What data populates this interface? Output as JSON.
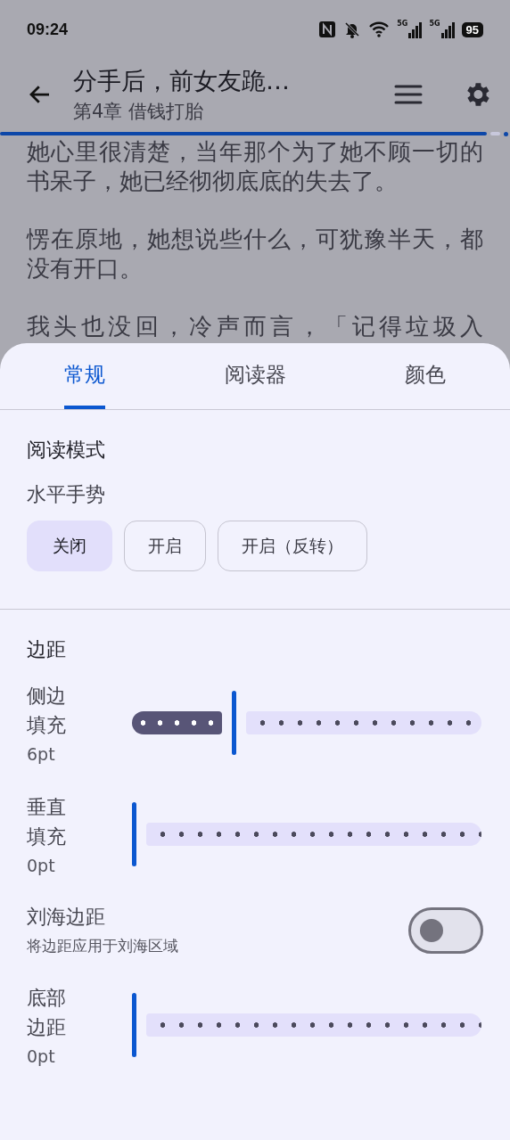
{
  "status_bar": {
    "time": "09:24",
    "signals": [
      "5G",
      "5G"
    ],
    "battery": "95"
  },
  "header": {
    "title": "分手后，前女友跪…",
    "subtitle": "第4章 借钱打胎"
  },
  "reading_progress": {
    "level": 0.955
  },
  "reader": {
    "paragraphs": [
      "她心里很清楚，当年那个为了她不顾一切的书呆子，她已经彻彻底底的失去了。",
      "愣在原地，她想说些什么，可犹豫半天，都没有开口。"
    ],
    "cut_line": "我头也没回，冷声而言，「记得垃圾入"
  },
  "tabs": [
    {
      "label": "常规",
      "selected": true
    },
    {
      "label": "阅读器",
      "selected": false
    },
    {
      "label": "颜色",
      "selected": false
    }
  ],
  "sections": [
    {
      "title": "阅读模式",
      "items": [
        {
          "kind": "chips",
          "label": "水平手势",
          "options": [
            {
              "label": "关闭",
              "selected": true
            },
            {
              "label": "开启",
              "selected": false
            },
            {
              "label": "开启（反转）",
              "selected": false
            }
          ]
        }
      ]
    },
    {
      "title": "边距",
      "items": [
        {
          "kind": "slider",
          "label": "侧边填充",
          "value": "6pt",
          "level": 0.26
        },
        {
          "kind": "slider",
          "label": "垂直填充",
          "value": "0pt",
          "level": 0
        },
        {
          "kind": "toggle",
          "label": "刘海边距",
          "subtitle": "将边距应用于刘海区域",
          "on": false
        },
        {
          "kind": "slider",
          "label": "底部边距",
          "value": "0pt",
          "level": 0
        }
      ]
    }
  ]
}
